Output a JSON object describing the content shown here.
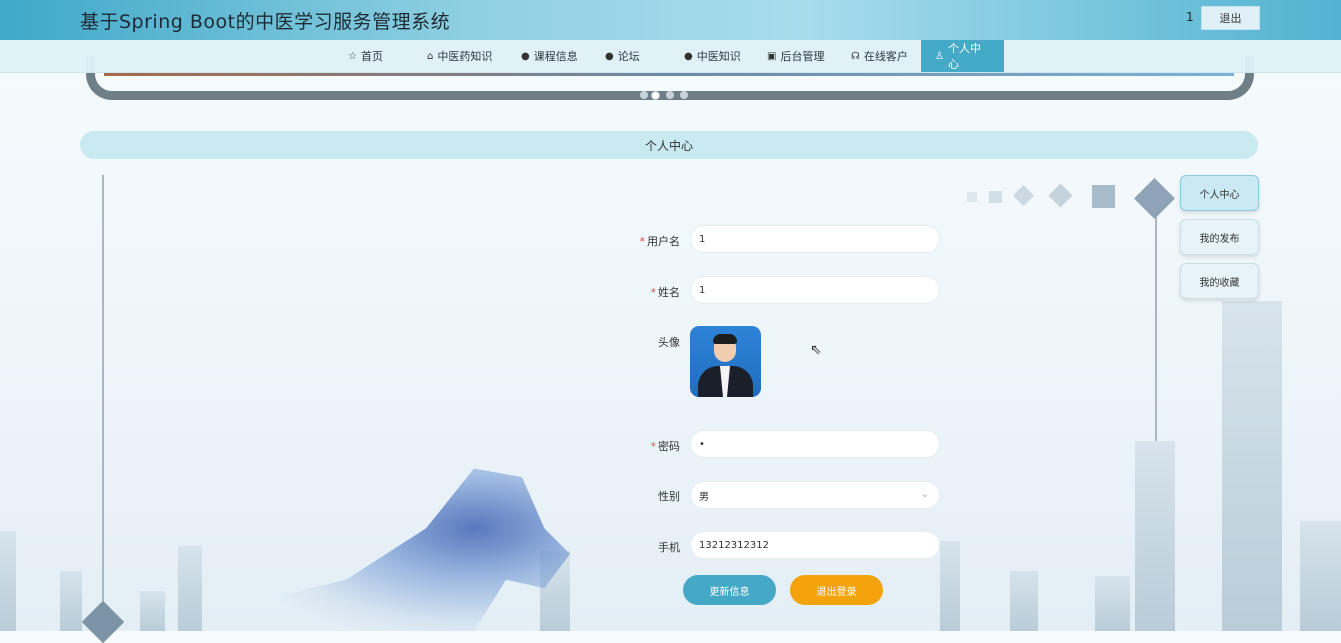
{
  "header": {
    "site_title": "基于Spring Boot的中医学习服务管理系统",
    "user_name": "1",
    "logout_label": "退出"
  },
  "nav": {
    "items": [
      {
        "label": "首页",
        "icon": "star-icon"
      },
      {
        "label": "中医药知识",
        "icon": "bag-icon"
      },
      {
        "label": "课程信息",
        "icon": "info-icon"
      },
      {
        "label": "论坛",
        "icon": "question-icon"
      },
      {
        "label": "中医知识",
        "icon": "info-icon"
      },
      {
        "label": "后台管理",
        "icon": "briefcase-icon"
      },
      {
        "label": "在线客户",
        "icon": "headset-icon"
      },
      {
        "label": "个人中心",
        "icon": "user-icon",
        "active": true
      }
    ]
  },
  "section": {
    "title": "个人中心"
  },
  "side_menu": {
    "items": [
      {
        "label": "个人中心",
        "active": true
      },
      {
        "label": "我的发布"
      },
      {
        "label": "我的收藏"
      }
    ]
  },
  "form": {
    "username": {
      "label": "用户名",
      "value": "1",
      "required": true
    },
    "name": {
      "label": "姓名",
      "value": "1",
      "required": true
    },
    "avatar": {
      "label": "头像"
    },
    "password": {
      "label": "密码",
      "value": "•",
      "required": true
    },
    "gender": {
      "label": "性别",
      "value": "男"
    },
    "phone": {
      "label": "手机",
      "value": "13212312312"
    }
  },
  "buttons": {
    "update_label": "更新信息",
    "logout_label": "退出登录"
  },
  "colors": {
    "accent": "#45a9c8",
    "update_button": "#46a8c7",
    "logout_button": "#f5a30c",
    "required_mark": "#e04b4b"
  }
}
